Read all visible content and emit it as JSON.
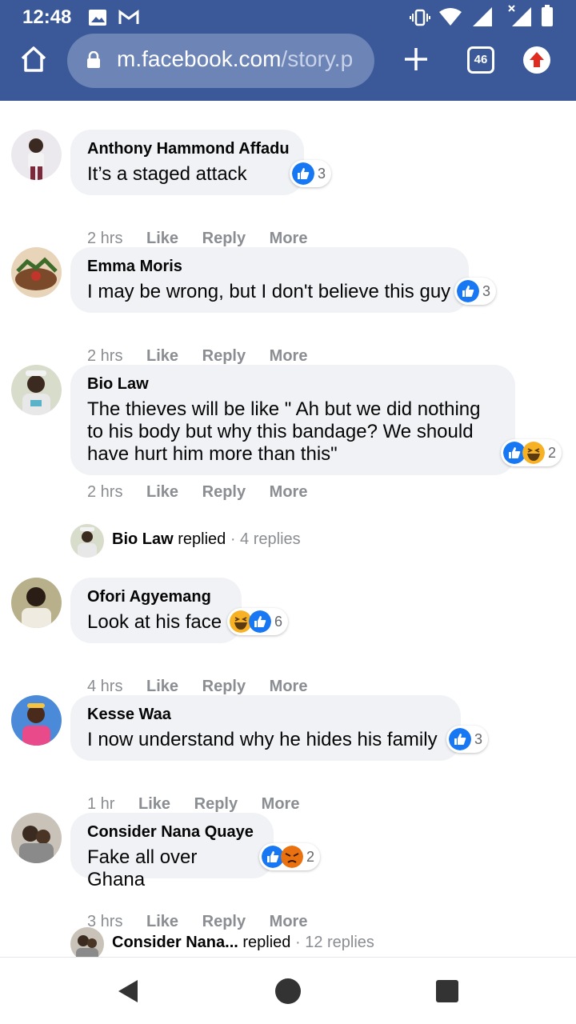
{
  "status": {
    "time": "12:48"
  },
  "browser": {
    "url_host": "m.facebook.com",
    "url_path": "/story.p",
    "tab_count": "46"
  },
  "comments": [
    {
      "name": "Anthony Hammond Affadu",
      "text": "It’s a staged attack",
      "reaction_count": "3",
      "time": "2 hrs",
      "like": "Like",
      "reply": "Reply",
      "more": "More"
    },
    {
      "name": "Emma Moris",
      "text": "I may be wrong, but I don't believe this guy",
      "reaction_count": "3",
      "time": "2 hrs",
      "like": "Like",
      "reply": "Reply",
      "more": "More"
    },
    {
      "name": "Bio Law",
      "text": "The thieves will be like \" Ah but we did nothing to his body but why this bandage? We should have hurt him more than this\"",
      "reaction_count": "2",
      "time": "2 hrs",
      "like": "Like",
      "reply": "Reply",
      "more": "More"
    },
    {
      "name": "Ofori Agyemang",
      "text": "Look at his face",
      "reaction_count": "6",
      "time": "4 hrs",
      "like": "Like",
      "reply": "Reply",
      "more": "More"
    },
    {
      "name": "Kesse Waa",
      "text": "I now understand why he hides his family",
      "reaction_count": "3",
      "time": "1 hr",
      "like": "Like",
      "reply": "Reply",
      "more": "More"
    },
    {
      "name": "Consider Nana Quaye",
      "text": "Fake all over Ghana",
      "reaction_count": "2",
      "time": "3 hrs",
      "like": "Like",
      "reply": "Reply",
      "more": "More"
    }
  ],
  "replies": [
    {
      "who": "Bio Law",
      "verb": " replied",
      "count": " · 4 replies"
    },
    {
      "who": "Consider Nana...",
      "verb": " replied",
      "count": " · 12 replies"
    }
  ],
  "colors": {
    "header": "#3b5998",
    "like_blue": "#1877f2",
    "haha_yellow": "#f7b125",
    "angry_orange": "#e9710f"
  }
}
